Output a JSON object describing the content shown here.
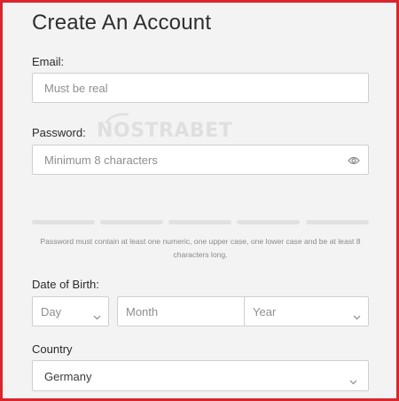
{
  "form": {
    "title": "Create An Account",
    "email": {
      "label": "Email:",
      "placeholder": "Must be real"
    },
    "password": {
      "label": "Password:",
      "placeholder": "Minimum 8 characters",
      "hint": "Password must contain at least one numeric, one upper case, one lower case and be at least 8 characters long."
    },
    "dob": {
      "label": "Date of Birth:",
      "day": "Day",
      "month": "Month",
      "year": "Year"
    },
    "country": {
      "label": "Country",
      "value": "Germany"
    }
  },
  "watermark": "NOSTRABET",
  "icons": {
    "password_toggle": "eye-icon",
    "dropdown": "chevron-down-icon"
  },
  "colors": {
    "frame_border": "#d9252b",
    "background": "#f3f3f3",
    "strength_empty": "#e1e1e1"
  }
}
